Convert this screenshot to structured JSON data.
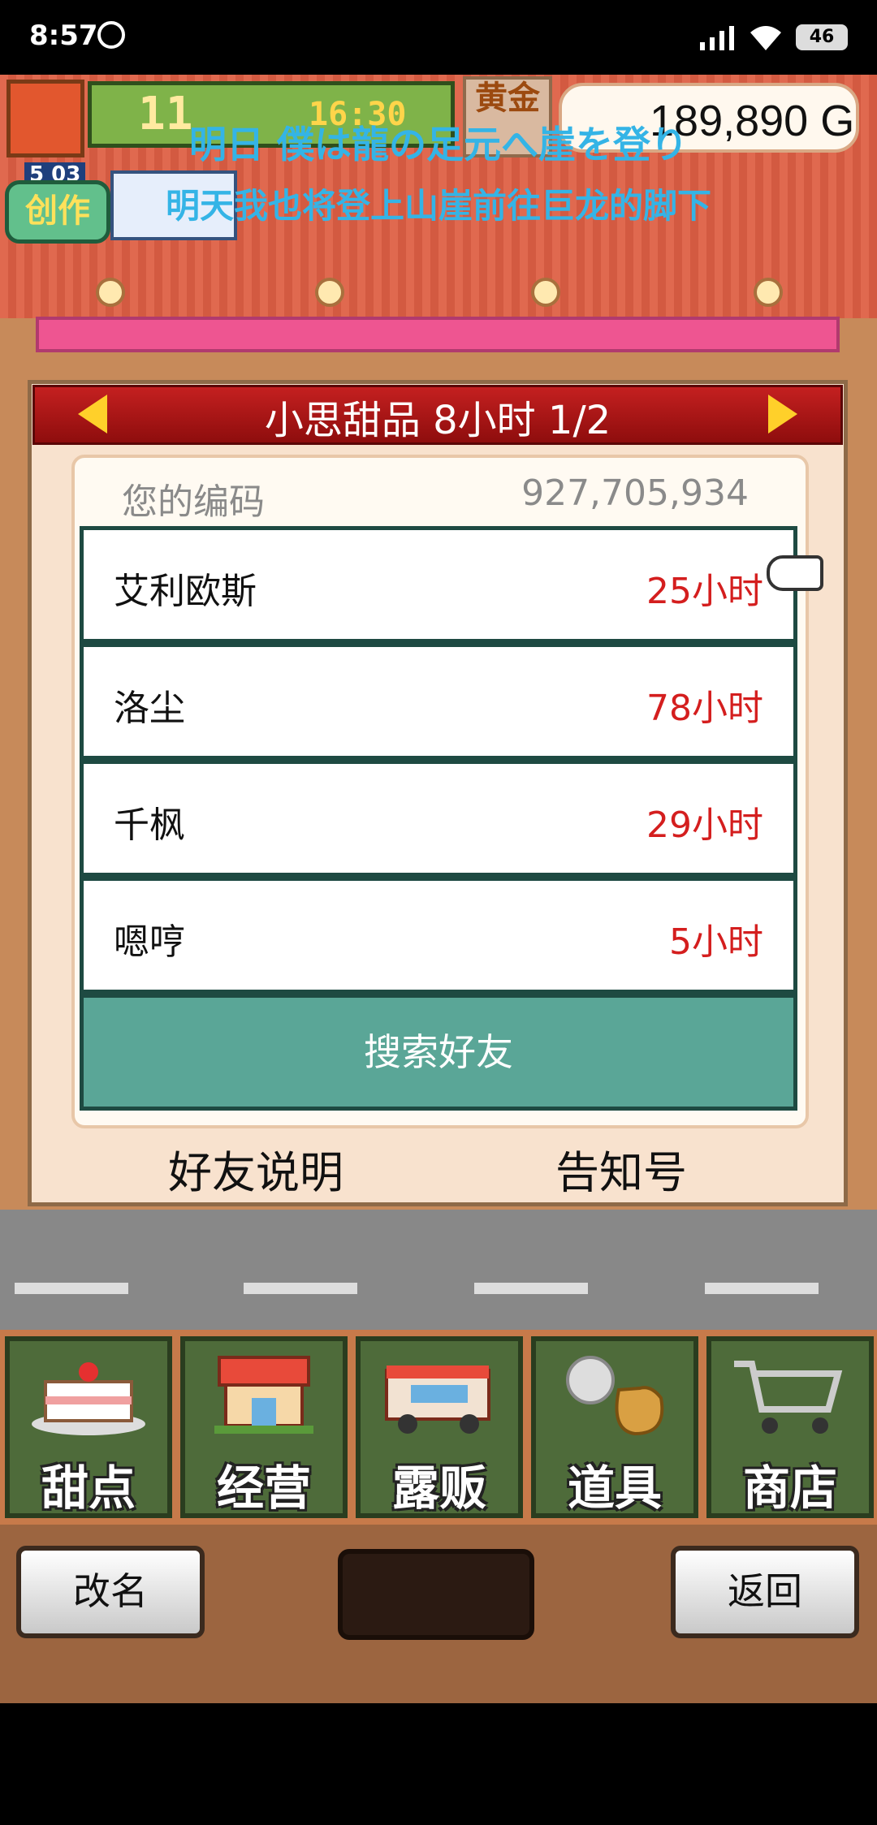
{
  "status_bar": {
    "time": "8:57",
    "battery": "46",
    "icons": [
      "sync-icon",
      "signal-icon",
      "wifi-icon",
      "battery-icon"
    ]
  },
  "hud": {
    "day": "11",
    "time": "16:30",
    "gold_label": "黄金",
    "money": "189,890 G",
    "create_label": "创作",
    "create_stats": "5 03"
  },
  "subtitles": {
    "japanese": "明日 僕は龍の足元へ崖を登り",
    "chinese": "明天我也将登上山崖前往巨龙的脚下"
  },
  "dialog": {
    "title": "小思甜品  8小时 1/2",
    "code_label": "您的编码",
    "code_value": "927,705,934",
    "friends": [
      {
        "name": "艾利欧斯",
        "hours": "25小时"
      },
      {
        "name": "洛尘",
        "hours": "78小时"
      },
      {
        "name": "千枫",
        "hours": "29小时"
      },
      {
        "name": "嗯哼",
        "hours": "5小时"
      }
    ],
    "search_button": "搜索好友",
    "friend_help": "好友说明",
    "notice_id": "告知号"
  },
  "menu": {
    "items": [
      {
        "label": "甜点",
        "icon": "cake-icon"
      },
      {
        "label": "经营",
        "icon": "shop-building-icon"
      },
      {
        "label": "露贩",
        "icon": "food-truck-icon"
      },
      {
        "label": "道具",
        "icon": "item-bag-icon"
      },
      {
        "label": "商店",
        "icon": "shopping-cart-icon"
      }
    ]
  },
  "bottom": {
    "rename": "改名",
    "back": "返回"
  },
  "colors": {
    "header_red": "#c42020",
    "search_teal": "#5aa697",
    "hours_red": "#d41e1e",
    "subtitle_blue": "#34b4e6"
  }
}
